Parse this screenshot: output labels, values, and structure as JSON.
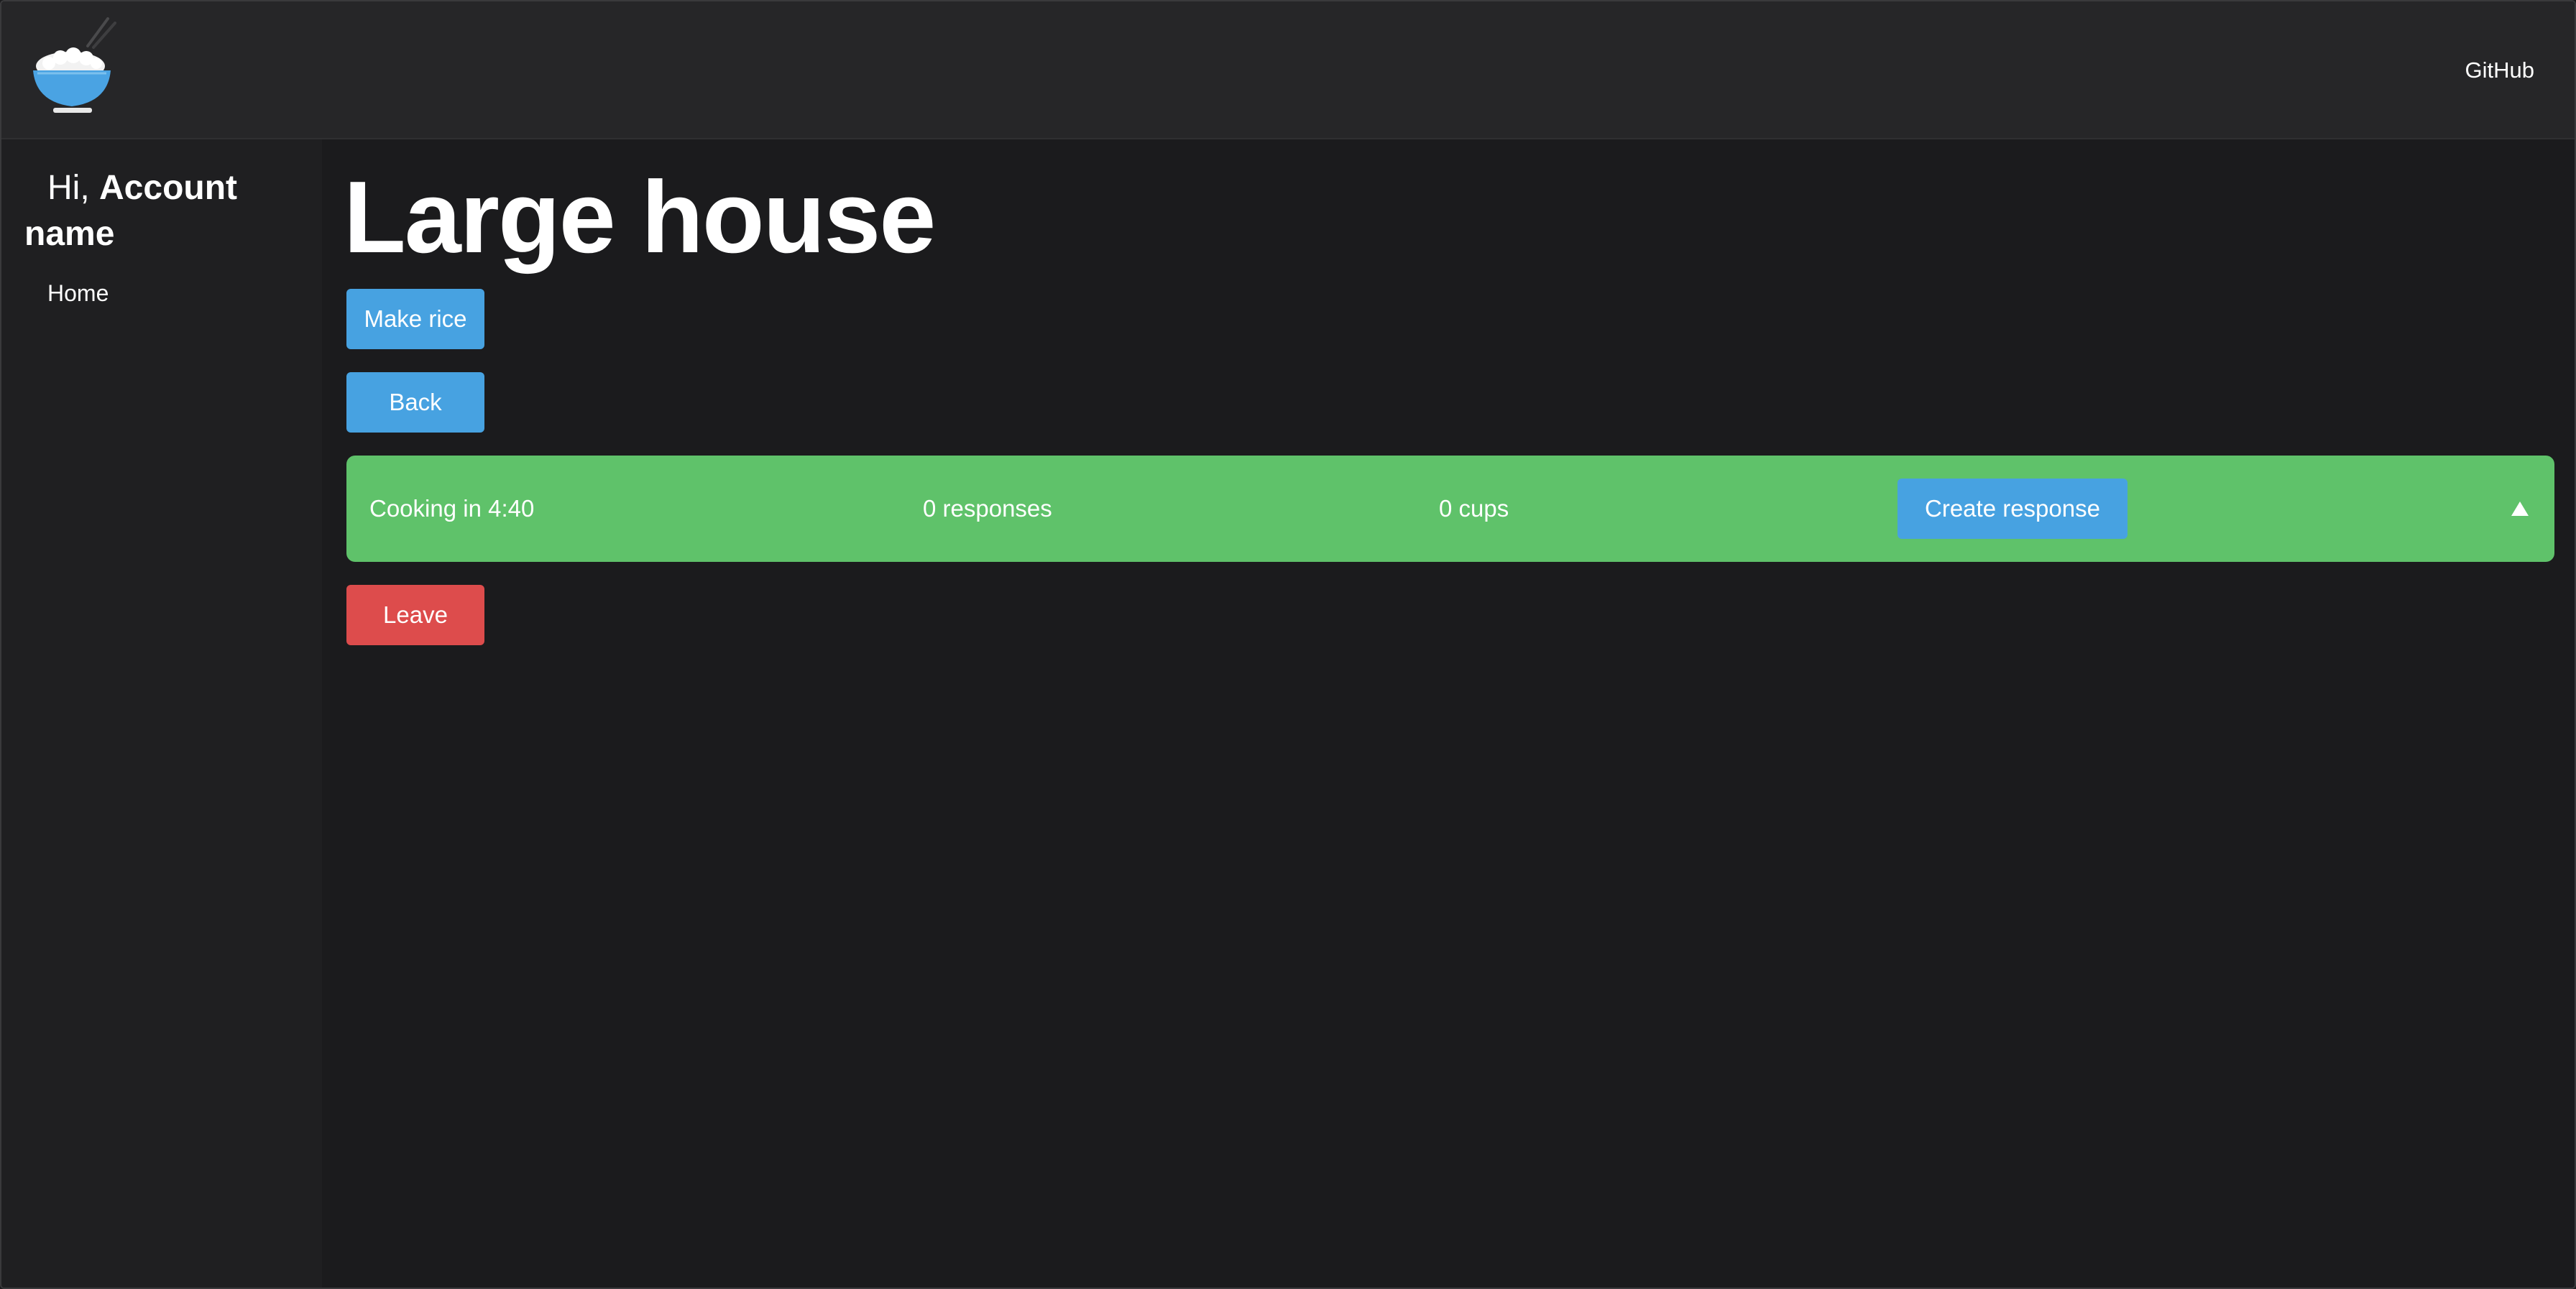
{
  "nav": {
    "logo_icon": "rice-bowl-icon",
    "github_label": "GitHub"
  },
  "sidebar": {
    "greeting_prefix": "Hi,",
    "account_name": "Account name",
    "items": [
      {
        "label": "Home"
      }
    ]
  },
  "main": {
    "title": "Large house",
    "make_rice_label": "Make rice",
    "back_label": "Back",
    "leave_label": "Leave",
    "room_card": {
      "status": "Cooking in 4:40",
      "responses": "0 responses",
      "cups": "0 cups",
      "create_response_label": "Create response",
      "toggle_icon": "caret-up-icon"
    }
  },
  "colors": {
    "background": "#1b1b1d",
    "topbar": "#262628",
    "sidebar": "#1f1f21",
    "card_green": "#5fc26a",
    "button_blue": "#47a2e1",
    "button_red": "#dd4c4c"
  }
}
